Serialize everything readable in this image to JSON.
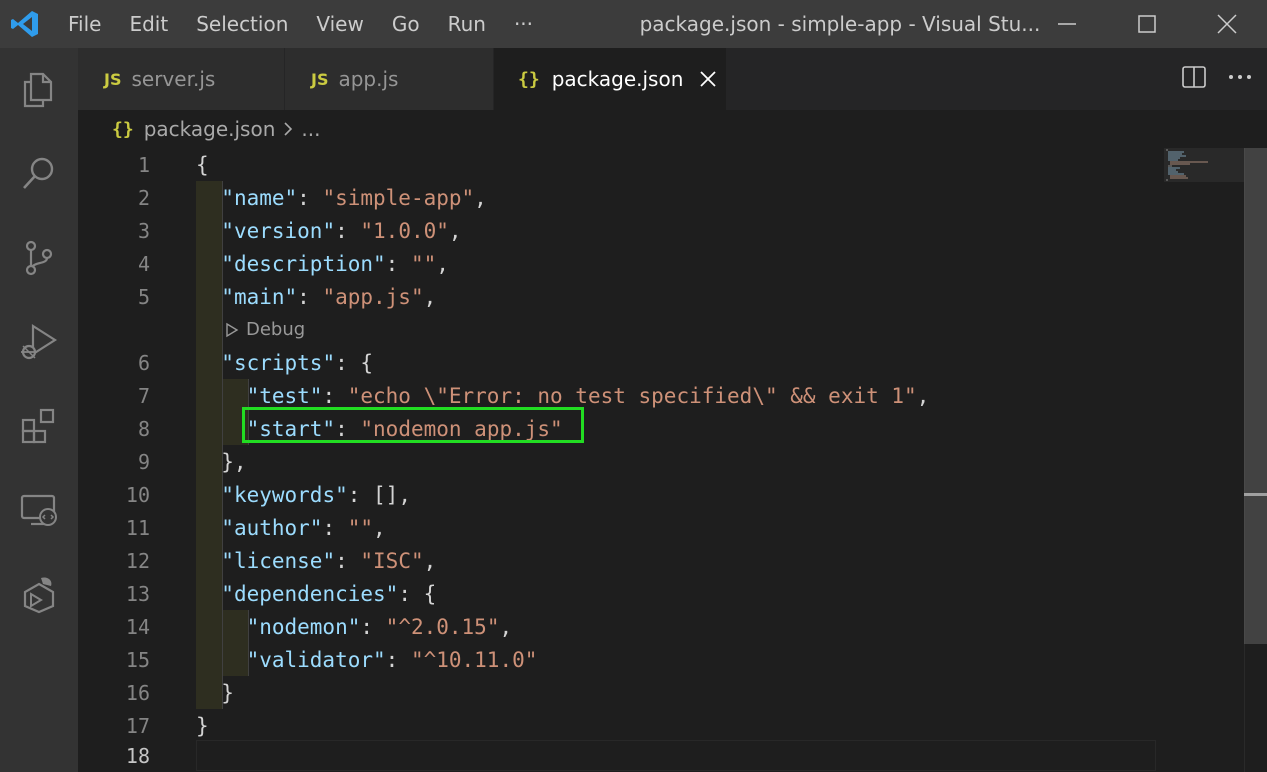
{
  "titlebar": {
    "menu": [
      "File",
      "Edit",
      "Selection",
      "View",
      "Go",
      "Run",
      "···"
    ],
    "window_title": "package.json - simple-app - Visual Stu..."
  },
  "activity_icons": [
    "explorer-icon",
    "search-icon",
    "source-control-icon",
    "run-debug-icon",
    "extensions-icon",
    "remote-explorer-icon",
    "docker-icon"
  ],
  "tabs": [
    {
      "badge": "JS",
      "label": "server.js",
      "active": false
    },
    {
      "badge": "JS",
      "label": "app.js",
      "active": false
    },
    {
      "badge": "{}",
      "label": "package.json",
      "active": true
    }
  ],
  "breadcrumb": {
    "badge": "{}",
    "file": "package.json",
    "more": "..."
  },
  "codelens": {
    "label": "Debug"
  },
  "code_lines": [
    {
      "n": "1"
    },
    {
      "n": "2"
    },
    {
      "n": "3"
    },
    {
      "n": "4"
    },
    {
      "n": "5"
    },
    {
      "n": "6"
    },
    {
      "n": "7"
    },
    {
      "n": "8"
    },
    {
      "n": "9"
    },
    {
      "n": "10"
    },
    {
      "n": "11"
    },
    {
      "n": "12"
    },
    {
      "n": "13"
    },
    {
      "n": "14"
    },
    {
      "n": "15"
    },
    {
      "n": "16"
    },
    {
      "n": "17"
    },
    {
      "n": "18"
    }
  ],
  "json": {
    "name_key": "\"name\"",
    "name_val": "\"simple-app\"",
    "version_key": "\"version\"",
    "version_val": "\"1.0.0\"",
    "description_key": "\"description\"",
    "description_val": "\"\"",
    "main_key": "\"main\"",
    "main_val": "\"app.js\"",
    "scripts_key": "\"scripts\"",
    "test_key": "\"test\"",
    "test_val": "\"echo \\\"Error: no test specified\\\" && exit 1\"",
    "start_key": "\"start\"",
    "start_val": "\"nodemon app.js\"",
    "keywords_key": "\"keywords\"",
    "keywords_val": "[]",
    "author_key": "\"author\"",
    "author_val": "\"\"",
    "license_key": "\"license\"",
    "license_val": "\"ISC\"",
    "dependencies_key": "\"dependencies\"",
    "nodemon_key": "\"nodemon\"",
    "nodemon_val": "\"^2.0.15\"",
    "validator_key": "\"validator\"",
    "validator_val": "\"^10.11.0\""
  },
  "colors": {
    "json_key": "#9cdcfe",
    "json_string": "#ce9178",
    "highlight_box": "#22dd22",
    "js_badge": "#cbcb41"
  }
}
